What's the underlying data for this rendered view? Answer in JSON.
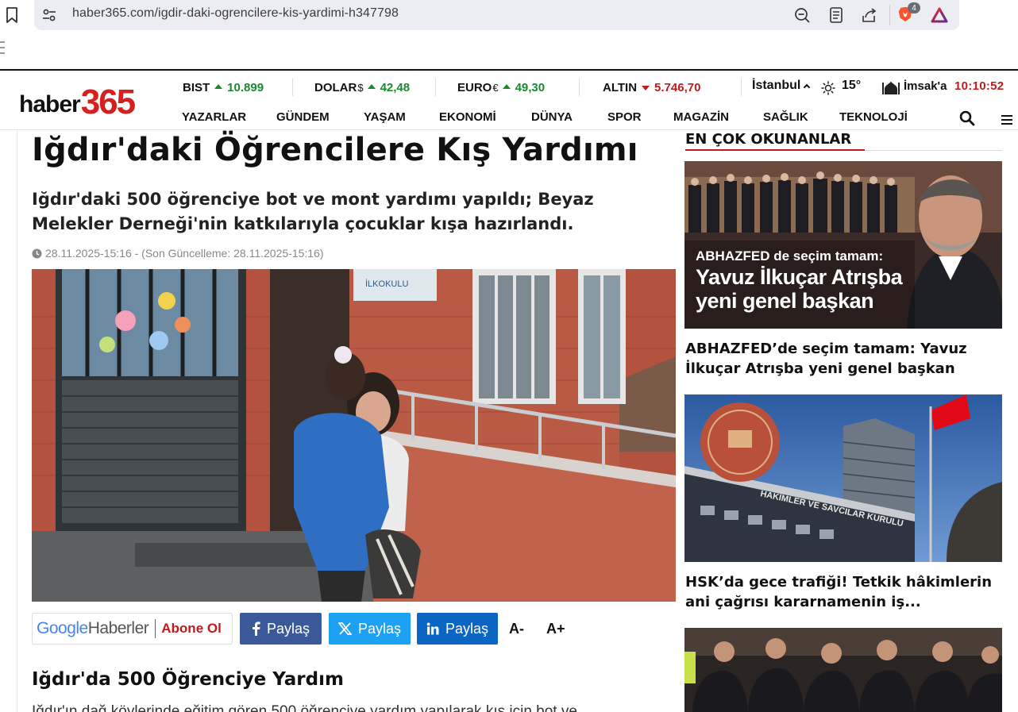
{
  "browser": {
    "url": "haber365.com/igdir-daki-ogrencilere-kis-yardimi-h347798",
    "brave_badge": "4"
  },
  "site": {
    "logo_text": "haber",
    "logo_number": "365"
  },
  "ticker": [
    {
      "label": "BIST",
      "currency": "",
      "value": "10.899",
      "direction": "up"
    },
    {
      "label": "DOLAR",
      "currency": "$",
      "value": "42,48",
      "direction": "up"
    },
    {
      "label": "EURO",
      "currency": "€",
      "value": "49,30",
      "direction": "up"
    },
    {
      "label": "ALTIN",
      "currency": "",
      "value": "5.746,70",
      "direction": "down"
    }
  ],
  "weather": {
    "city": "İstanbul",
    "temperature": "15°"
  },
  "prayer": {
    "label": "İmsak'a",
    "countdown": "10:10:52"
  },
  "nav": [
    "YAZARLAR",
    "GÜNDEM",
    "YAŞAM",
    "EKONOMİ",
    "DÜNYA",
    "SPOR",
    "MAGAZİN",
    "SAĞLIK",
    "TEKNOLOJİ"
  ],
  "article": {
    "title": "Iğdır'daki Öğrencilere Kış Yardımı",
    "spot": "Iğdır'daki 500 öğrenciye bot ve mont yardımı yapıldı; Beyaz Melekler Derneği'nin katkılarıyla çocuklar kışa hazırlandı.",
    "date": "28.11.2025-15:16 - (Son Güncelleme: 28.11.2025-15:16)",
    "sign_text": "İLKOKULU",
    "google_news": {
      "google": "Google",
      "haberler": "Haberler",
      "subscribe": "Abone Ol"
    },
    "share_label": "Paylaş",
    "font_smaller": "A-",
    "font_larger": "A+",
    "subheading": "Iğdır'da 500 Öğrenciye Yardım",
    "body_snippet": "Iğdır'ın dağ köylerinde eğitim gören 500 öğrenciye yardım yapılarak kış için bot ve"
  },
  "sidebar": {
    "title": "EN ÇOK OKUNANLAR",
    "items": [
      {
        "title": "ABHAZFED’de seçim tamam: Yavuz İlkuçar Atrışba yeni genel başkan",
        "overlay_small": "ABHAZFED de seçim tamam:",
        "overlay_line1": "Yavuz İlkuçar Atrışba",
        "overlay_line2": "yeni genel başkan"
      },
      {
        "title": "HSK’da gece trafiği! Tetkik hâkimlerin ani çağrısı kararnamenin iş...",
        "building_sign": "HAKİMLER VE SAVCILAR KURULU"
      },
      {
        "title": ""
      }
    ]
  },
  "colors": {
    "brand_red": "#d4201f",
    "up_green": "#1a8a2e",
    "down_red": "#c21a1a",
    "facebook": "#3b5998",
    "twitter": "#1da1f2",
    "linkedin": "#0a66c2"
  }
}
